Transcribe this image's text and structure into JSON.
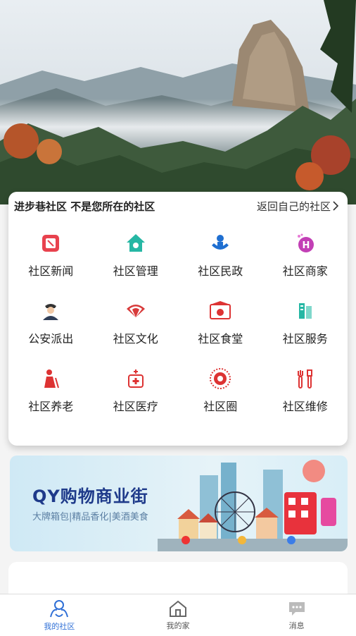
{
  "header": {
    "community_notice": "进步巷社区 不是您所在的社区",
    "back_link": "返回自己的社区"
  },
  "services": [
    {
      "label": "社区新闻",
      "icon": "news-icon"
    },
    {
      "label": "社区管理",
      "icon": "house-manage-icon"
    },
    {
      "label": "社区民政",
      "icon": "civil-affairs-icon"
    },
    {
      "label": "社区商家",
      "icon": "merchant-icon"
    },
    {
      "label": "公安派出",
      "icon": "police-icon"
    },
    {
      "label": "社区文化",
      "icon": "fan-culture-icon"
    },
    {
      "label": "社区食堂",
      "icon": "canteen-icon"
    },
    {
      "label": "社区服务",
      "icon": "service-icon"
    },
    {
      "label": "社区养老",
      "icon": "elderly-icon"
    },
    {
      "label": "社区医疗",
      "icon": "medical-icon"
    },
    {
      "label": "社区圈",
      "icon": "circle-icon"
    },
    {
      "label": "社区维修",
      "icon": "repair-icon"
    }
  ],
  "banner": {
    "title": "QY购物商业街",
    "subtitle": "大牌箱包|精品香化|美酒美食"
  },
  "tabbar": {
    "tabs": [
      {
        "label": "我的社区",
        "icon": "community-icon",
        "active": true
      },
      {
        "label": "我的家",
        "icon": "home-icon",
        "active": false
      },
      {
        "label": "消息",
        "icon": "message-icon",
        "active": false
      }
    ]
  },
  "colors": {
    "accent": "#2f6fd6",
    "banner_title": "#1e3a8a"
  }
}
